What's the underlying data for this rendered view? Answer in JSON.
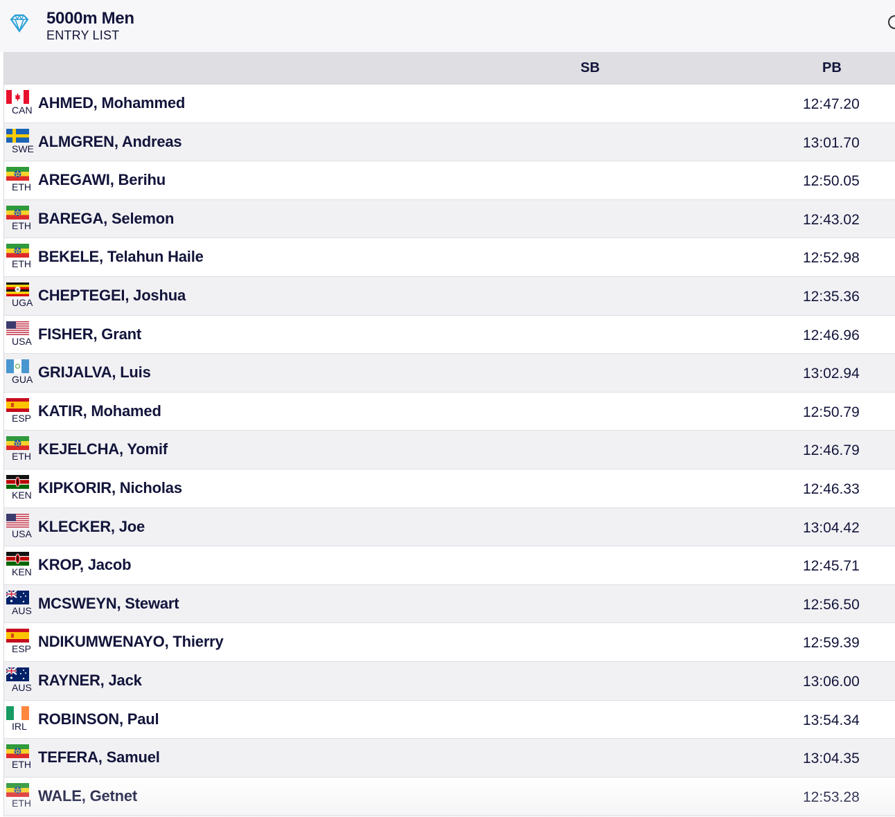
{
  "header": {
    "title": "5000m Men",
    "subtitle": "ENTRY LIST",
    "logo_icon": "diamond-icon",
    "accent_color": "#2a9fd6"
  },
  "table": {
    "columns": {
      "sb": "SB",
      "pb": "PB"
    },
    "rows": [
      {
        "country": "CAN",
        "flag": "flag-can",
        "name": "AHMED, Mohammed",
        "sb": "",
        "pb": "12:47.20"
      },
      {
        "country": "SWE",
        "flag": "flag-swe",
        "name": "ALMGREN, Andreas",
        "sb": "",
        "pb": "13:01.70"
      },
      {
        "country": "ETH",
        "flag": "flag-eth",
        "name": "AREGAWI, Berihu",
        "sb": "",
        "pb": "12:50.05"
      },
      {
        "country": "ETH",
        "flag": "flag-eth",
        "name": "BAREGA, Selemon",
        "sb": "",
        "pb": "12:43.02"
      },
      {
        "country": "ETH",
        "flag": "flag-eth",
        "name": "BEKELE, Telahun Haile",
        "sb": "",
        "pb": "12:52.98"
      },
      {
        "country": "UGA",
        "flag": "flag-uga",
        "name": "CHEPTEGEI, Joshua",
        "sb": "",
        "pb": "12:35.36"
      },
      {
        "country": "USA",
        "flag": "flag-usa",
        "name": "FISHER, Grant",
        "sb": "",
        "pb": "12:46.96"
      },
      {
        "country": "GUA",
        "flag": "flag-gua",
        "name": "GRIJALVA, Luis",
        "sb": "",
        "pb": "13:02.94"
      },
      {
        "country": "ESP",
        "flag": "flag-esp",
        "name": "KATIR, Mohamed",
        "sb": "",
        "pb": "12:50.79"
      },
      {
        "country": "ETH",
        "flag": "flag-eth",
        "name": "KEJELCHA, Yomif",
        "sb": "",
        "pb": "12:46.79"
      },
      {
        "country": "KEN",
        "flag": "flag-ken",
        "name": "KIPKORIR, Nicholas",
        "sb": "",
        "pb": "12:46.33"
      },
      {
        "country": "USA",
        "flag": "flag-usa",
        "name": "KLECKER, Joe",
        "sb": "",
        "pb": "13:04.42"
      },
      {
        "country": "KEN",
        "flag": "flag-ken",
        "name": "KROP, Jacob",
        "sb": "",
        "pb": "12:45.71"
      },
      {
        "country": "AUS",
        "flag": "flag-aus",
        "name": "MCSWEYN, Stewart",
        "sb": "",
        "pb": "12:56.50"
      },
      {
        "country": "ESP",
        "flag": "flag-esp",
        "name": "NDIKUMWENAYO, Thierry",
        "sb": "",
        "pb": "12:59.39"
      },
      {
        "country": "AUS",
        "flag": "flag-aus",
        "name": "RAYNER, Jack",
        "sb": "",
        "pb": "13:06.00"
      },
      {
        "country": "IRL",
        "flag": "flag-irl",
        "name": "ROBINSON, Paul",
        "sb": "",
        "pb": "13:54.34"
      },
      {
        "country": "ETH",
        "flag": "flag-eth",
        "name": "TEFERA, Samuel",
        "sb": "",
        "pb": "13:04.35"
      },
      {
        "country": "ETH",
        "flag": "flag-eth",
        "name": "WALE, Getnet",
        "sb": "",
        "pb": "12:53.28"
      }
    ]
  }
}
